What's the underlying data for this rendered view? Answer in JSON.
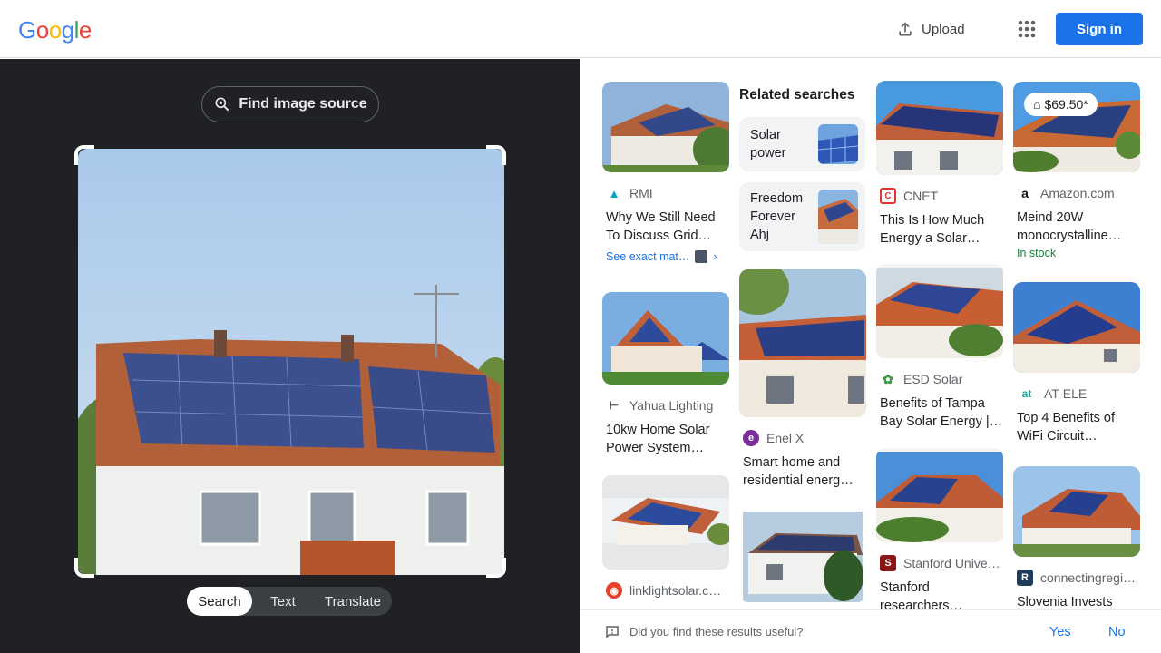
{
  "header": {
    "logo": [
      "G",
      "o",
      "o",
      "g",
      "l",
      "e"
    ],
    "logo_colors": [
      "#4285F4",
      "#EA4335",
      "#FBBC05",
      "#4285F4",
      "#34A853",
      "#EA4335"
    ],
    "upload_label": "Upload",
    "signin_label": "Sign in"
  },
  "lens": {
    "find_source_label": "Find image source",
    "modes": [
      "Search",
      "Text",
      "Translate"
    ],
    "active_mode": "Search"
  },
  "related": {
    "heading": "Related searches",
    "items": [
      {
        "label": "Solar power"
      },
      {
        "label": "Freedom Forever Ahj"
      }
    ]
  },
  "results": [
    {
      "source": "RMI",
      "title": "Why We Still Need To Discuss Grid…",
      "exact": "See exact mat…",
      "favicon": "rmi-icon"
    },
    {
      "source": "CNET",
      "title": "This Is How Much Energy a Solar…",
      "favicon": "cnet-icon"
    },
    {
      "source": "Amazon.com",
      "title": "Meind 20W monocrystalline…",
      "price": "$69.50*",
      "stock": "In stock",
      "favicon": "amazon-icon"
    },
    {
      "source": "Yahua Lighting",
      "title": "10kw Home Solar Power System…",
      "favicon": "yahua-icon"
    },
    {
      "source": "Enel X",
      "title": "Smart home and residential energ…",
      "favicon": "enel-icon"
    },
    {
      "source": "ESD Solar",
      "title": "Benefits of Tampa Bay Solar Energy |…",
      "favicon": "esd-icon"
    },
    {
      "source": "AT-ELE",
      "title": "Top 4 Benefits of WiFi Circuit…",
      "favicon": "atele-icon"
    },
    {
      "source": "linklightsolar.c…",
      "title": "",
      "favicon": "linklight-icon"
    },
    {
      "source": "Stanford Unive…",
      "title": "Stanford researchers…",
      "favicon": "stanford-icon"
    },
    {
      "source": "connectingregi…",
      "title": "Slovenia Invests",
      "favicon": "connecting-icon"
    }
  ],
  "feedback": {
    "question": "Did you find these results useful?",
    "yes": "Yes",
    "no": "No"
  }
}
